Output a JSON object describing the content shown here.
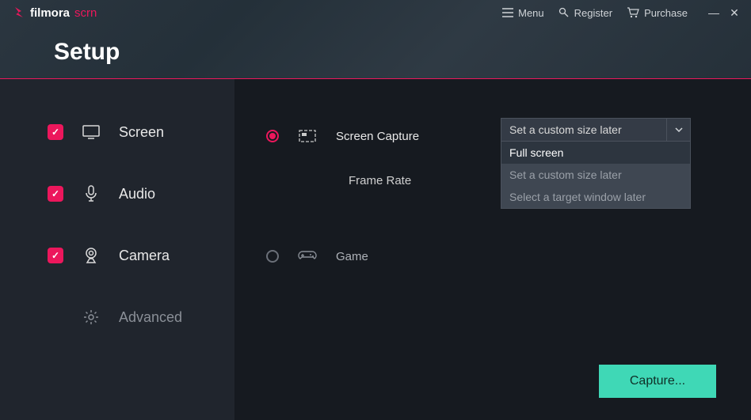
{
  "brand": {
    "name": "filmora",
    "suffix": "scrn"
  },
  "topbar": {
    "menu": "Menu",
    "register": "Register",
    "purchase": "Purchase"
  },
  "title": "Setup",
  "sidebar": {
    "items": [
      {
        "label": "Screen",
        "checked": true
      },
      {
        "label": "Audio",
        "checked": true
      },
      {
        "label": "Camera",
        "checked": true
      },
      {
        "label": "Advanced",
        "checked": false
      }
    ]
  },
  "content": {
    "screen_capture_label": "Screen Capture",
    "frame_rate_label": "Frame Rate",
    "game_label": "Game",
    "select_value": "Set a custom size later",
    "dropdown": [
      "Full screen",
      "Set a custom size later",
      "Select a target window later"
    ]
  },
  "capture_button": "Capture...",
  "colors": {
    "accent": "#ec175c",
    "cta": "#3fd8b6"
  }
}
